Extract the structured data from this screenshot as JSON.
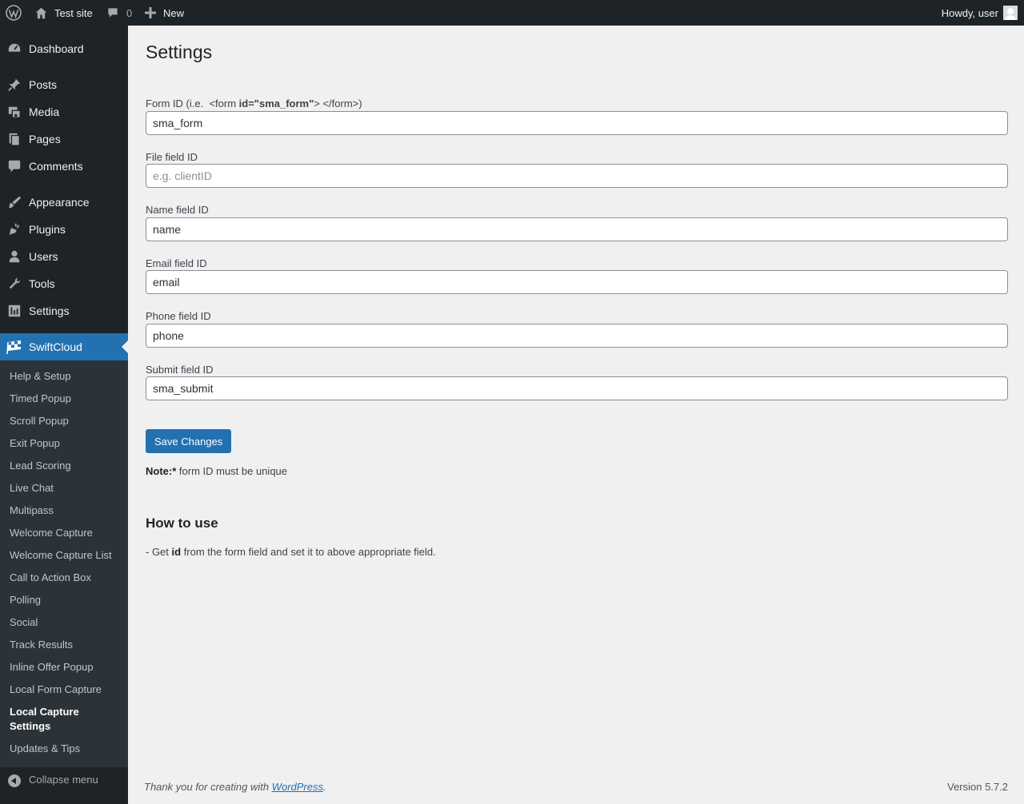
{
  "admin_bar": {
    "site_name": "Test site",
    "comments_count": "0",
    "new_label": "New",
    "howdy": "Howdy, user"
  },
  "sidebar": {
    "items": [
      {
        "label": "Dashboard",
        "icon": "dashboard-icon"
      },
      {
        "label": "Posts",
        "icon": "pushpin-icon"
      },
      {
        "label": "Media",
        "icon": "media-icon"
      },
      {
        "label": "Pages",
        "icon": "pages-icon"
      },
      {
        "label": "Comments",
        "icon": "comment-icon"
      },
      {
        "label": "Appearance",
        "icon": "brush-icon"
      },
      {
        "label": "Plugins",
        "icon": "plugin-icon"
      },
      {
        "label": "Users",
        "icon": "user-icon"
      },
      {
        "label": "Tools",
        "icon": "wrench-icon"
      },
      {
        "label": "Settings",
        "icon": "settings-icon"
      },
      {
        "label": "SwiftCloud",
        "icon": "checkered-flag-icon"
      }
    ],
    "submenu": [
      "Help & Setup",
      "Timed Popup",
      "Scroll Popup",
      "Exit Popup",
      "Lead Scoring",
      "Live Chat",
      "Multipass",
      "Welcome Capture",
      "Welcome Capture List",
      "Call to Action Box",
      "Polling",
      "Social",
      "Track Results",
      "Inline Offer Popup",
      "Local Form Capture",
      "Local Capture Settings",
      "Updates & Tips"
    ],
    "collapse_label": "Collapse menu"
  },
  "main": {
    "title": "Settings",
    "form_id_label": {
      "prefix": "Form ID (i.e.  <form ",
      "bold": "id=\"sma_form\"",
      "suffix": "> </form>)"
    },
    "fields": [
      {
        "label": "Form ID",
        "value": "sma_form",
        "placeholder": ""
      },
      {
        "label": "File field ID",
        "value": "",
        "placeholder": "e.g. clientID"
      },
      {
        "label": "Name field ID",
        "value": "name",
        "placeholder": ""
      },
      {
        "label": "Email field ID",
        "value": "email",
        "placeholder": ""
      },
      {
        "label": "Phone field ID",
        "value": "phone",
        "placeholder": ""
      },
      {
        "label": "Submit field ID",
        "value": "sma_submit",
        "placeholder": ""
      }
    ],
    "save_label": "Save Changes",
    "note_bold": "Note:*",
    "note_text": " form ID must be unique",
    "how_to_title": "How to use",
    "how_to_prefix": "- Get ",
    "how_to_bold": "id",
    "how_to_suffix": " from the form field and set it to above appropriate field."
  },
  "footer": {
    "thanks_prefix": "Thank you for creating with ",
    "link_text": "WordPress",
    "thanks_suffix": ".",
    "version": "Version 5.7.2"
  },
  "colors": {
    "admin_bg": "#1d2327",
    "submenu_bg": "#2c3338",
    "accent": "#2271b1",
    "page_bg": "#f0f0f1"
  }
}
